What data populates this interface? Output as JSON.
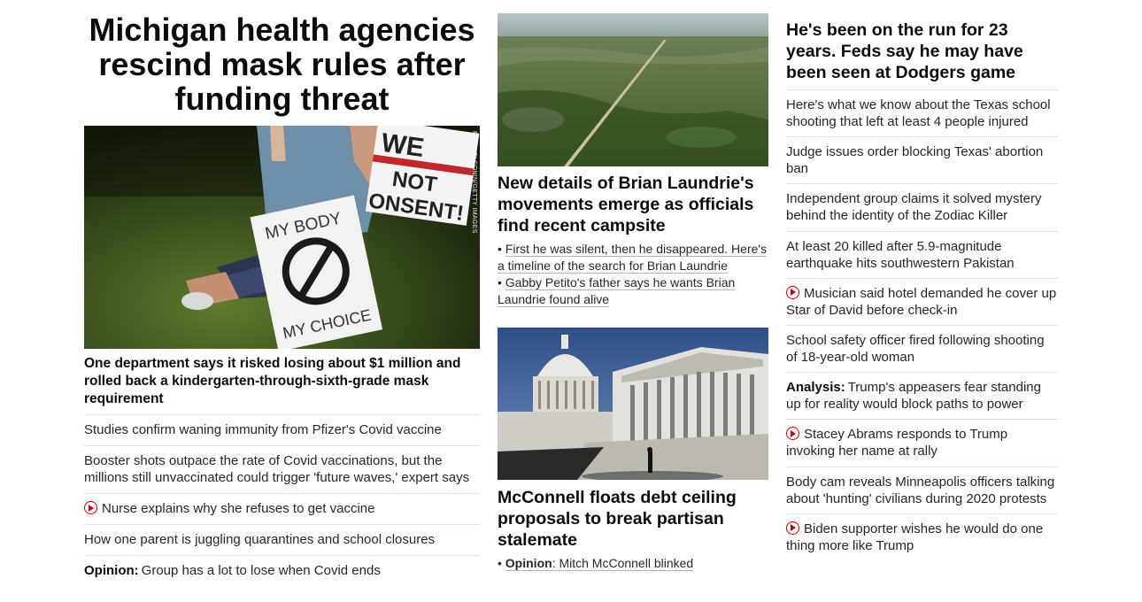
{
  "lead": {
    "title": "Michigan health agencies rescind mask rules after funding threat",
    "subheadline": "One department says it risked losing about $1 million and rolled back a kindergarten-through-sixth-grade mask requirement",
    "image_credit": "EMILY ELCONIN/GETTY IMAGES",
    "sign_text_1": "WE",
    "sign_text_2": "NOT",
    "sign_text_3": "ONSENT!",
    "sign_text_4": "MY BODY",
    "sign_text_5": "MY CHOICE"
  },
  "left_list": [
    {
      "prefix": "",
      "video": false,
      "text": "Studies confirm waning immunity from Pfizer's Covid vaccine"
    },
    {
      "prefix": "",
      "video": false,
      "text": "Booster shots outpace the rate of Covid vaccinations, but the millions still unvaccinated could trigger 'future waves,' expert says"
    },
    {
      "prefix": "",
      "video": true,
      "text": "Nurse explains why she refuses to get vaccine"
    },
    {
      "prefix": "",
      "video": false,
      "text": "How one parent is juggling quarantines and school closures"
    },
    {
      "prefix": "Opinion:",
      "video": false,
      "text": "Group has a lot to lose when Covid ends"
    }
  ],
  "middle": {
    "story1": {
      "title": "New details of Brian Laundrie's movements emerge as officials find recent campsite",
      "bullets": [
        "First he was silent, then he disappeared. Here's a timeline of the search for Brian Laundrie",
        "Gabby Petito's father says he wants Brian Laundrie found alive"
      ]
    },
    "story2": {
      "title": "McConnell floats debt ceiling proposals to break partisan stalemate",
      "bullet_prefix": "Opinion",
      "bullet_text": ": Mitch McConnell blinked"
    }
  },
  "right": {
    "title": "He's been on the run for 23 years. Feds say he may have been seen at Dodgers game",
    "items": [
      {
        "prefix": "",
        "video": false,
        "text": "Here's what we know about the Texas school shooting that left at least 4 people injured"
      },
      {
        "prefix": "",
        "video": false,
        "text": "Judge issues order blocking Texas' abortion ban"
      },
      {
        "prefix": "",
        "video": false,
        "text": "Independent group claims it solved mystery behind the identity of the Zodiac Killer"
      },
      {
        "prefix": "",
        "video": false,
        "text": "At least 20 killed after 5.9-magnitude earthquake hits southwestern Pakistan"
      },
      {
        "prefix": "",
        "video": true,
        "text": "Musician said hotel demanded he cover up Star of David before check-in"
      },
      {
        "prefix": "",
        "video": false,
        "text": "School safety officer fired following shooting of 18-year-old woman"
      },
      {
        "prefix": "Analysis:",
        "video": false,
        "text": "Trump's appeasers fear standing up for reality would block paths to power"
      },
      {
        "prefix": "",
        "video": true,
        "text": "Stacey Abrams responds to Trump invoking her name at rally"
      },
      {
        "prefix": "",
        "video": false,
        "text": "Body cam reveals Minneapolis officers talking about 'hunting' civilians during 2020 protests"
      },
      {
        "prefix": "",
        "video": true,
        "text": "Biden supporter wishes he would do one thing more like Trump"
      }
    ]
  },
  "colors": {
    "video_icon": "#cc0000",
    "divider": "#e0e0e0",
    "headline": "#0c0c0c"
  }
}
